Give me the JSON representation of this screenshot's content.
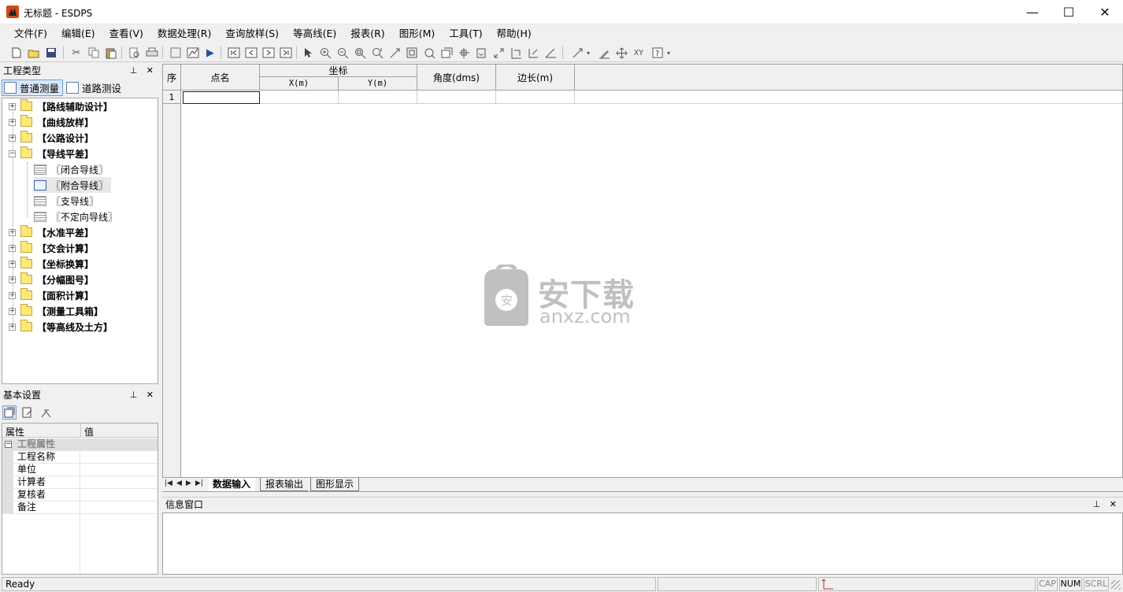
{
  "window": {
    "title": "无标题 - ESDPS",
    "minimize_icon": "—",
    "maximize_icon": "☐",
    "close_icon": "✕"
  },
  "menu": [
    "文件(F)",
    "编辑(E)",
    "查看(V)",
    "数据处理(R)",
    "查询放样(S)",
    "等高线(E)",
    "报表(R)",
    "图形(M)",
    "工具(T)",
    "帮助(H)"
  ],
  "project_panel": {
    "title": "工程类型",
    "tabs": [
      "普通测量",
      "道路测设"
    ],
    "tree": [
      {
        "label": "【路线辅助设计】",
        "expander": "+"
      },
      {
        "label": "【曲线放样】",
        "expander": "+"
      },
      {
        "label": "【公路设计】",
        "expander": "+"
      },
      {
        "label": "【导线平差】",
        "expander": "−",
        "children": [
          "〖闭合导线〗",
          "〖附合导线〗",
          "〖支导线〗",
          "〖不定向导线〗"
        ]
      },
      {
        "label": "【水准平差】",
        "expander": "+"
      },
      {
        "label": "【交会计算】",
        "expander": "+"
      },
      {
        "label": "【坐标换算】",
        "expander": "+"
      },
      {
        "label": "【分幅图号】",
        "expander": "+"
      },
      {
        "label": "【面积计算】",
        "expander": "+"
      },
      {
        "label": "【测量工具箱】",
        "expander": "+"
      },
      {
        "label": "【等高线及土方】",
        "expander": "+"
      }
    ]
  },
  "settings_panel": {
    "title": "基本设置",
    "col_property": "属性",
    "col_value": "值",
    "group": "工程属性",
    "group_expander": "−",
    "rows": [
      "工程名称",
      "单位",
      "计算者",
      "复核者",
      "备注"
    ]
  },
  "panel_pin_close": "⊥ ✕",
  "grid": {
    "col_seq": "序",
    "col_name": "点名",
    "col_coord": "坐标",
    "col_x": "X(m)",
    "col_y": "Y(m)",
    "col_angle": "角度(dms)",
    "col_length": "边长(m)",
    "row1": "1"
  },
  "sheets": {
    "nav": [
      "|◀",
      "◀",
      "▶",
      "▶|"
    ],
    "tabs": [
      "数据输入",
      "报表输出",
      "图形显示"
    ]
  },
  "info_window": {
    "title": "信息窗口"
  },
  "statusbar": {
    "status": "Ready",
    "indicators": [
      "CAP",
      "NUM",
      "SCRL"
    ]
  },
  "watermark": {
    "main": "安下载",
    "sub": "anxz.com"
  },
  "colors": {
    "selection_border": "#7a9fd0",
    "folder": "#fde878"
  }
}
